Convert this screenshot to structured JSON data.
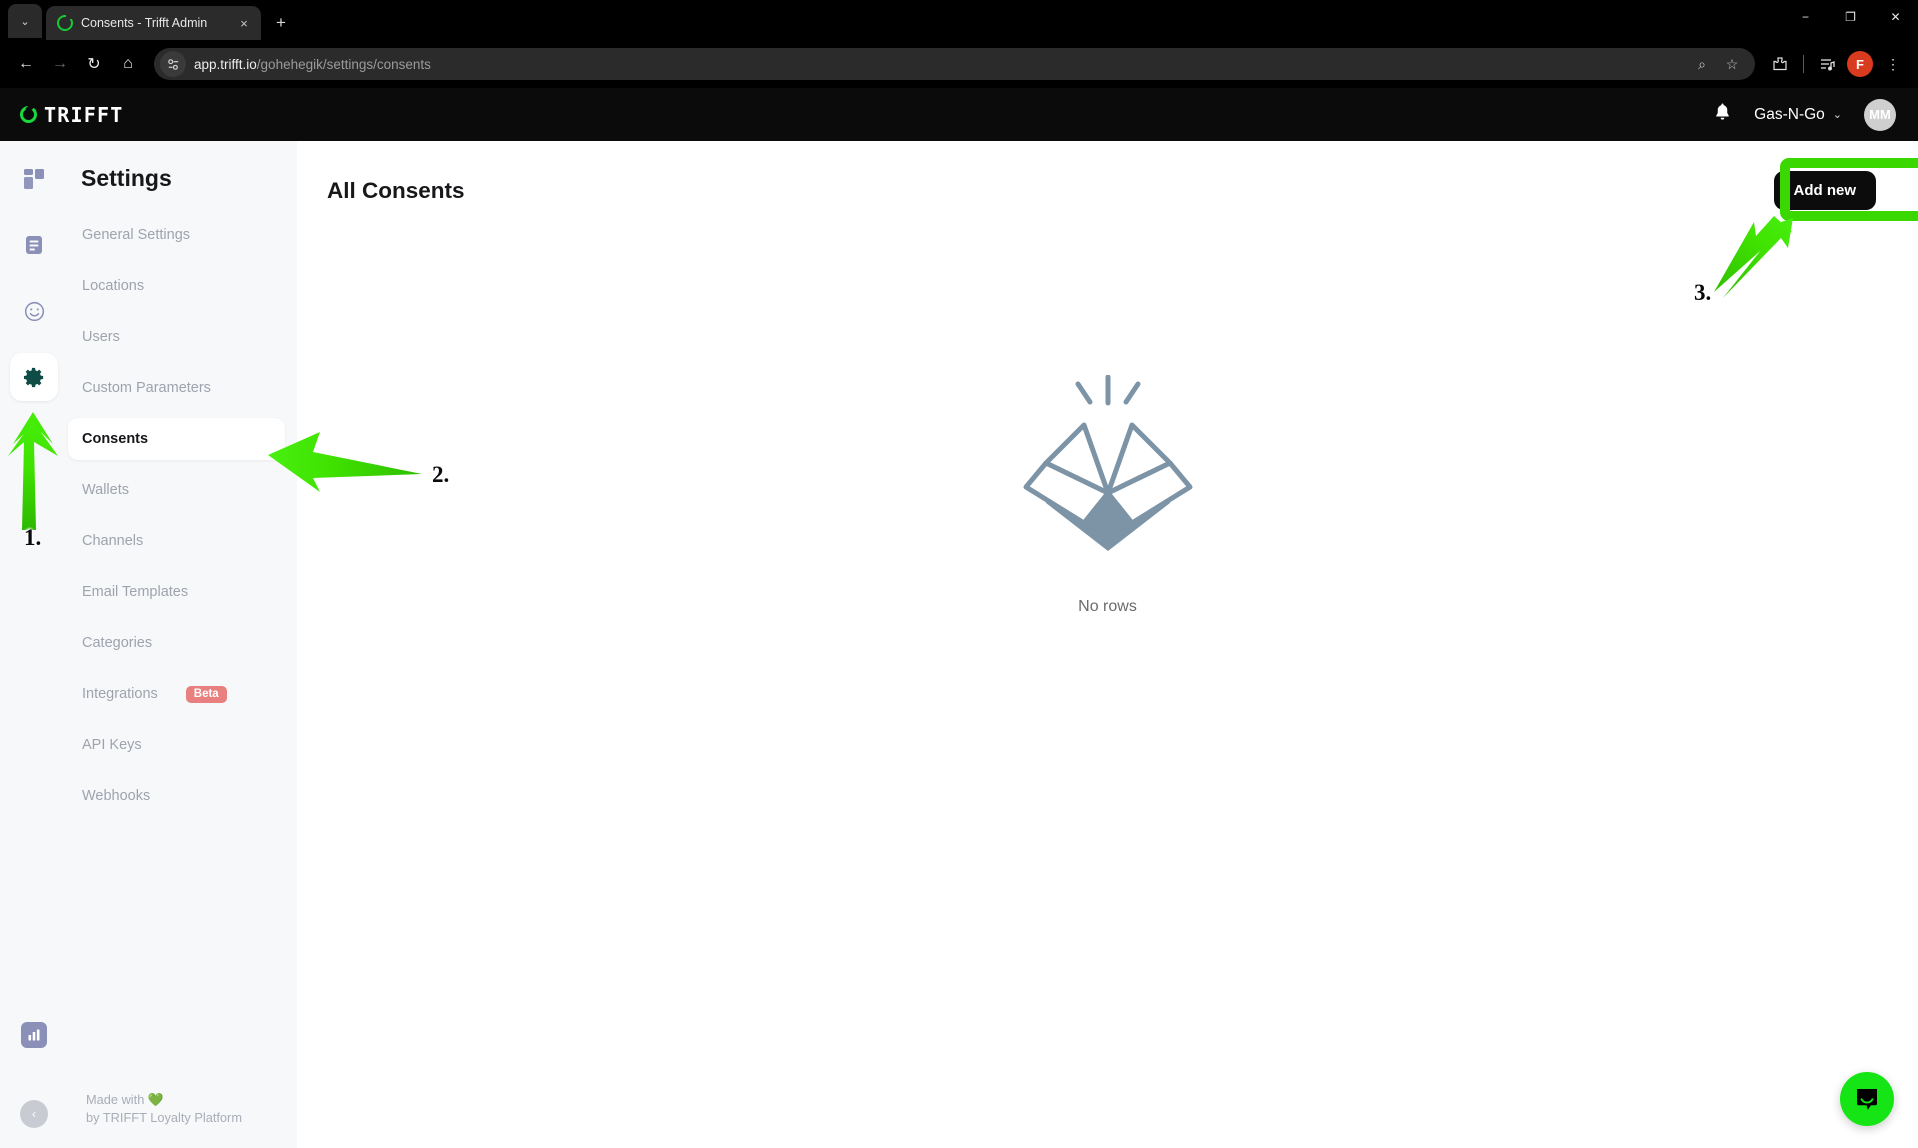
{
  "browser": {
    "tab": {
      "title": "Consents - Trifft Admin",
      "favicon": "trifft-logo-icon",
      "close": "×"
    },
    "new_tab": "+",
    "tab_list_chevron": "⌄",
    "window": {
      "minimize": "−",
      "maximize": "❐",
      "close": "✕"
    },
    "nav": {
      "back": "←",
      "forward": "→",
      "reload": "↻",
      "home": "⌂"
    },
    "url": {
      "host": "app.trifft.io",
      "path": "/gohehegik/settings/consents"
    },
    "url_actions": {
      "zoom": "⌕",
      "bookmark": "☆"
    },
    "toolbar_actions": {
      "extensions": "⧉",
      "reading_list": "≡",
      "profile_initial": "F",
      "menu": "⋮"
    }
  },
  "appbar": {
    "logo_text": "TRIFFT",
    "notifications_icon": "bell-icon",
    "org_name": "Gas-N-Go",
    "org_chevron": "⌄",
    "avatar_initials": "MM"
  },
  "sidebar": {
    "rail": [
      {
        "name": "dashboard-icon",
        "active": false
      },
      {
        "name": "content-icon",
        "active": false
      },
      {
        "name": "customers-icon",
        "active": false
      },
      {
        "name": "settings-gear-icon",
        "active": true
      }
    ],
    "rail_bottom": {
      "analytics_icon": "chart-icon",
      "collapse_icon": "‹"
    },
    "title": "Settings",
    "items": [
      {
        "label": "General Settings",
        "active": false,
        "badge": null
      },
      {
        "label": "Locations",
        "active": false,
        "badge": null
      },
      {
        "label": "Users",
        "active": false,
        "badge": null
      },
      {
        "label": "Custom Parameters",
        "active": false,
        "badge": null
      },
      {
        "label": "Consents",
        "active": true,
        "badge": null
      },
      {
        "label": "Wallets",
        "active": false,
        "badge": null
      },
      {
        "label": "Channels",
        "active": false,
        "badge": null
      },
      {
        "label": "Email Templates",
        "active": false,
        "badge": null
      },
      {
        "label": "Categories",
        "active": false,
        "badge": null
      },
      {
        "label": "Integrations",
        "active": false,
        "badge": "Beta"
      },
      {
        "label": "API Keys",
        "active": false,
        "badge": null
      },
      {
        "label": "Webhooks",
        "active": false,
        "badge": null
      }
    ],
    "footer_line1": "Made with 💚",
    "footer_line2": "by TRIFFT Loyalty Platform"
  },
  "main": {
    "title": "All Consents",
    "add_button": "Add new",
    "empty_state": {
      "icon": "empty-box-icon",
      "label": "No rows"
    }
  },
  "annotations": {
    "highlight_color": "#3ad800",
    "step1": "1.",
    "step2": "2.",
    "step3": "3."
  },
  "widgets": {
    "intercom_label": "chat-bubble-icon"
  },
  "colors": {
    "accent_green": "#18d83c",
    "badge_beta": "#e8807f",
    "annotation_green": "#3ad800",
    "sidebar_bg": "#f7f8fa",
    "appbar_bg": "#0b0b0b",
    "empty_icon": "#7d94a6"
  }
}
